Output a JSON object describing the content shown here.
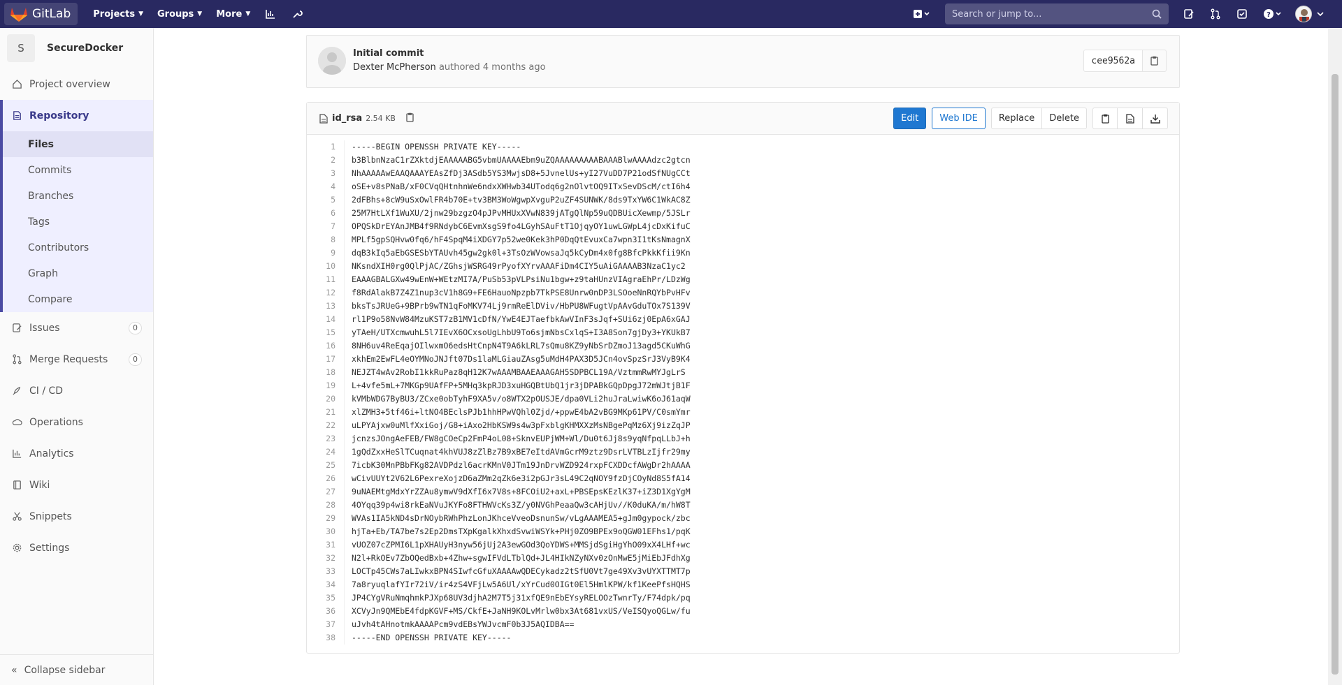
{
  "navbar": {
    "brand": "GitLab",
    "projects": "Projects",
    "groups": "Groups",
    "more": "More",
    "search_placeholder": "Search or jump to..."
  },
  "sidebar": {
    "project_initial": "S",
    "project_name": "SecureDocker",
    "project_overview": "Project overview",
    "repository": "Repository",
    "repo_items": [
      "Files",
      "Commits",
      "Branches",
      "Tags",
      "Contributors",
      "Graph",
      "Compare"
    ],
    "issues": "Issues",
    "issues_count": "0",
    "merge_requests": "Merge Requests",
    "merge_requests_count": "0",
    "cicd": "CI / CD",
    "operations": "Operations",
    "analytics": "Analytics",
    "wiki": "Wiki",
    "snippets": "Snippets",
    "settings": "Settings",
    "collapse": "Collapse sidebar"
  },
  "commit": {
    "title": "Initial commit",
    "author": "Dexter McPherson",
    "meta": "authored 4 months ago",
    "sha": "cee9562a"
  },
  "file": {
    "name": "id_rsa",
    "size": "2.54 KB",
    "buttons": {
      "edit": "Edit",
      "web_ide": "Web IDE",
      "replace": "Replace",
      "delete": "Delete"
    },
    "line_numbers": "1\n2\n3\n4\n5\n6\n7\n8\n9\n10\n11\n12\n13\n14\n15\n16\n17\n18\n19\n20\n21\n22\n23\n24\n25\n26\n27\n28\n29\n30\n31\n32\n33\n34\n35\n36\n37\n38",
    "content": "-----BEGIN OPENSSH PRIVATE KEY-----\nb3BlbnNzaC1rZXktdjEAAAAABG5vbmUAAAAEbm9uZQAAAAAAAAABAAABlwAAAAdzc2gtcn\nNhAAAAAwEAAQAAAYEAsZfDj3ASdb5YS3MwjsD8+5JvnelUs+yI27VuDD7P21odSfNUgCCt\noSE+v8sPNaB/xF0CVqQHtnhnWe6ndxXWHwb34UTodq6g2nOlvtOQ9ITxSevDScM/ctI6h4\n2dFBhs+8cW9uSxOwlFR4b70E+tv3BM3WoWgwpXvguP2uZF4SUNWK/8ds9TxYW6C1WkAC8Z\n25M7HtLXf1WuXU/2jnw29bzgzO4pJPvMHUxXVwN839jATgQlNp59uQDBUicXewmp/5JSLr\nOPQSkDrEYAnJMB4f9RNdybC6EvmXsgS9fo4LGyhSAuFtT1OjqyOY1uwLGWpL4jcDxKifuC\nMPLf5gpSQHvw0fq6/hF4SpqM4iXDGY7p52we0Kek3hP0DqQtEvuxCa7wpn3I1tKsNmagnX\ndqB3kIq5aEbGSESbYTAUvh45gw2gk0l+3TsOzWVowsaJq5kCyDm4x0fg8BfcPkkKfii9Kn\nNKsndXIH0rg0QlPjAC/ZGhsjWSRG49rPyofXYrvAAAFiDm4CIY5uAiGAAAAB3NzaC1yc2\nEAAAGBALGXw49wEnW+WEtzMI7A/PuSb53pVLPsiNu1bgw+z9taHUnzVIAgraEhPr/LDzWg\nf8RdAlakB7Z4Z1nup3cV1h8G9+FE6HauoNpzpb7TkPSE8Unrw0nDP3LSOoeNnRQYbPvHFv\nbksTsJRUeG+9BPrb9wTN1qFoMKV74Lj9rmReElDViv/HbPU8WFugtVpAAvGduTOx7S139V\nrl1P9o58NvW84MzuKST7zB1MV1cDfN/YwE4EJTaefbkAwVInF3sJqf+SUi6zj0EpA6xGAJ\nyTAeH/UTXcmwuhL5l7IEvX6OCxsoUgLhbU9To6sjmNbsCxlqS+I3A8Son7gjDy3+YKUkB7\n8NH6uv4ReEqajOIlwxmO6edsHtCnpN4T9A6kLRL7sQmu8KZ9yNbSrDZmoJ13agd5CKuWhG\nxkhEm2EwFL4eOYMNoJNJft07Ds1laMLGiauZAsg5uMdH4PAX3D5JCn4ovSpzSrJ3VyB9K4\nNEJZT4wAv2RobI1kkRuPaz8qH12K7wAAAMBAAEAAAGAH5SDPBCL19A/VztmmRwMYJgLrS\nL+4vfe5mL+7MKGp9UAfFP+5MHq3kpRJD3xuHGQBtUbQ1jr3jDPABkGQpDpgJ72mWJtjB1F\nkVMbWDG7ByBU3/ZCxe0obTyhF9XA5v/o8WTX2pOUSJE/dpa0VLi2huJraLwiwK6oJ61aqW\nxlZMH3+5tf46i+ltNO4BEclsPJb1hhHPwVQhl0Zjd/+ppwE4bA2vBG9MKp61PV/C0smYmr\nuLPYAjxw0uMlfXxiGoj/G8+iAxo2HbKSW9s4w3pFxblgKHMXXzMsNBgePqMz6Xj9izZqJP\njcnzsJOngAeFEB/FW8gCOeCp2FmP4oL08+SknvEUPjWM+Wl/Du0t6Jj8s9yqNfpqLLbJ+h\n1gQdZxxHeSlTCuqnat4khVUJ8zZlBz7B9xBE7eItdAVmGcrM9ztz9DsrLVTBLzIjfr29my\n7icbK30MnPBbFKg82AVDPdzl6acrKMnV0JTm19JnDrvWZD924rxpFCXDDcfAWgDr2hAAAA\nwCivUUYt2V62L6PexreXojzD6aZMm2qZk6e3i2pGJr3sL49C2qNOY9fzDjCOyNd8S5fA14\n9uNAEMtgMdxYrZZAu8ymwV9dXfI6x7V8s+8FCOiU2+axL+PBSEpsKEzlK37+iZ3D1XgYgM\n4OYqq39p4wi8rkEaNVuJKYFo8FTHWVcKs3Z/y0NVGhPeaaQw3cAHjUv//K0duKA/m/hW8T\nWVAs1IA5kND4sDrNOybRWhPhzLonJKhceVveoDsnunSw/vLgAAAMEA5+gJm0gypock/zbc\nhjTa+Eb/TA7be7s2Ep2DmsTXpKgalkXhxdSvwiWSYk+PHj0ZO9BPEx9oQGW01EFhs1/pqK\nvUOZ07cZPMI6L1pXHAUyH3nyw56jUj2A3ewGOd3QoYDWS+MMSjdSgiHgYhO09xX4LHf+wc\nN2l+RkOEv7ZbOQedBxb+4Zhw+sgwIFVdLTblQd+JL4HIkNZyNXv0zOnMwE5jMiEbJFdhXg\nLOCTp45CWs7aLIwkxBPN4SIwfcGfuXAAAAwQDECykadz2tSfU0Vt7ge49Xv3vUYXTTMT7p\n7a8ryuqlafYIr72iV/ir4zS4VFjLw5A6Ul/xYrCud0OIGt0El5HmlKPW/kf1KeePfsHQHS\nJP4CYgVRuNmqhmkPJXp68UV3djhA2M7T5j31xfQE9nEbEYsyRELOOzTwnrTy/F74dpk/pq\nXCVyJn9QMEbE4fdpKGVF+MS/CkfE+JaNH9KOLvMrlw0bx3At681vxUS/VeISQyoQGLw/fu\nuJvh4tAHnotmkAAAAPcm9vdEBsYWJvcmF0b3J5AQIDBA==\n-----END OPENSSH PRIVATE KEY-----"
  }
}
